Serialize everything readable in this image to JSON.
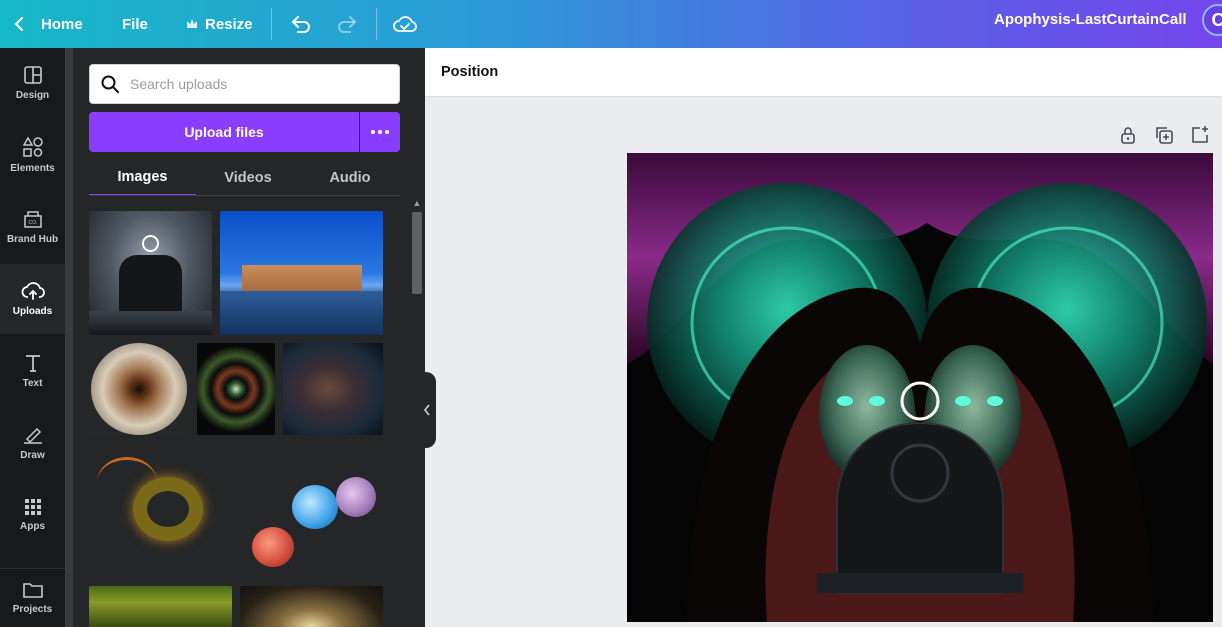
{
  "topbar": {
    "home_label": "Home",
    "file_label": "File",
    "resize_label": "Resize",
    "doc_title": "Apophysis-LastCurtainCall",
    "avatar_initial": "C",
    "icons": [
      "chevron-left-icon",
      "crown-icon",
      "undo-icon",
      "redo-icon",
      "cloud-check-icon"
    ]
  },
  "rail": {
    "items": [
      {
        "label": "Design",
        "icon": "layout-icon"
      },
      {
        "label": "Elements",
        "icon": "shapes-icon"
      },
      {
        "label": "Brand Hub",
        "icon": "brand-hub-icon"
      },
      {
        "label": "Uploads",
        "icon": "cloud-upload-icon",
        "active": true
      },
      {
        "label": "Text",
        "icon": "text-icon"
      },
      {
        "label": "Draw",
        "icon": "pen-icon"
      },
      {
        "label": "Apps",
        "icon": "apps-grid-icon"
      },
      {
        "label": "Projects",
        "icon": "folder-icon"
      }
    ]
  },
  "panel": {
    "search_placeholder": "Search uploads",
    "upload_label": "Upload files",
    "tabs": [
      {
        "label": "Images",
        "active": true
      },
      {
        "label": "Videos"
      },
      {
        "label": "Audio"
      }
    ]
  },
  "canvas": {
    "context_label": "Position",
    "page_tools": [
      "lock-icon",
      "duplicate-page-icon",
      "add-page-icon"
    ]
  },
  "colors": {
    "accent": "#8b3dff",
    "rail_bg": "#18191b",
    "panel_bg": "#252627",
    "canvas_bg": "#ebecf0"
  }
}
